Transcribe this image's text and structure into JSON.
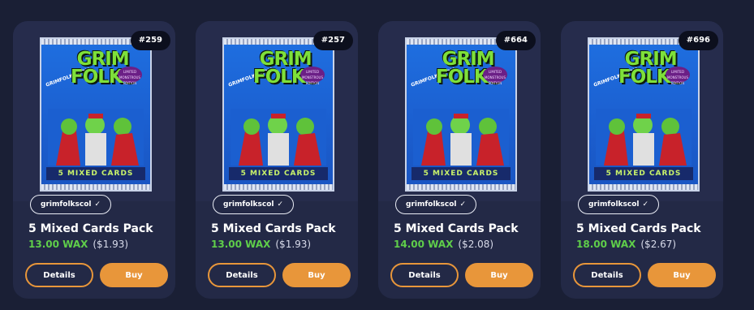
{
  "colors": {
    "background": "#1a1f35",
    "card": "#232946",
    "accent": "#e8963a",
    "wax_price": "#5fce4a"
  },
  "pack_art": {
    "logo_line1": "GRIM",
    "logo_line2": "FOLKS",
    "side_text": "GRIMFOLKS.COM",
    "seal_text": "LIMITED MONSTROUS EDITION",
    "banner_text": "5 MIXED CARDS"
  },
  "cards": [
    {
      "serial": "#259",
      "collection": "grimfolkscol",
      "name": "5 Mixed Cards Pack",
      "price_wax": "13.00 WAX",
      "price_usd": "($1.93)",
      "details_label": "Details",
      "buy_label": "Buy"
    },
    {
      "serial": "#257",
      "collection": "grimfolkscol",
      "name": "5 Mixed Cards Pack",
      "price_wax": "13.00 WAX",
      "price_usd": "($1.93)",
      "details_label": "Details",
      "buy_label": "Buy"
    },
    {
      "serial": "#664",
      "collection": "grimfolkscol",
      "name": "5 Mixed Cards Pack",
      "price_wax": "14.00 WAX",
      "price_usd": "($2.08)",
      "details_label": "Details",
      "buy_label": "Buy"
    },
    {
      "serial": "#696",
      "collection": "grimfolkscol",
      "name": "5 Mixed Cards Pack",
      "price_wax": "18.00 WAX",
      "price_usd": "($2.67)",
      "details_label": "Details",
      "buy_label": "Buy"
    }
  ]
}
